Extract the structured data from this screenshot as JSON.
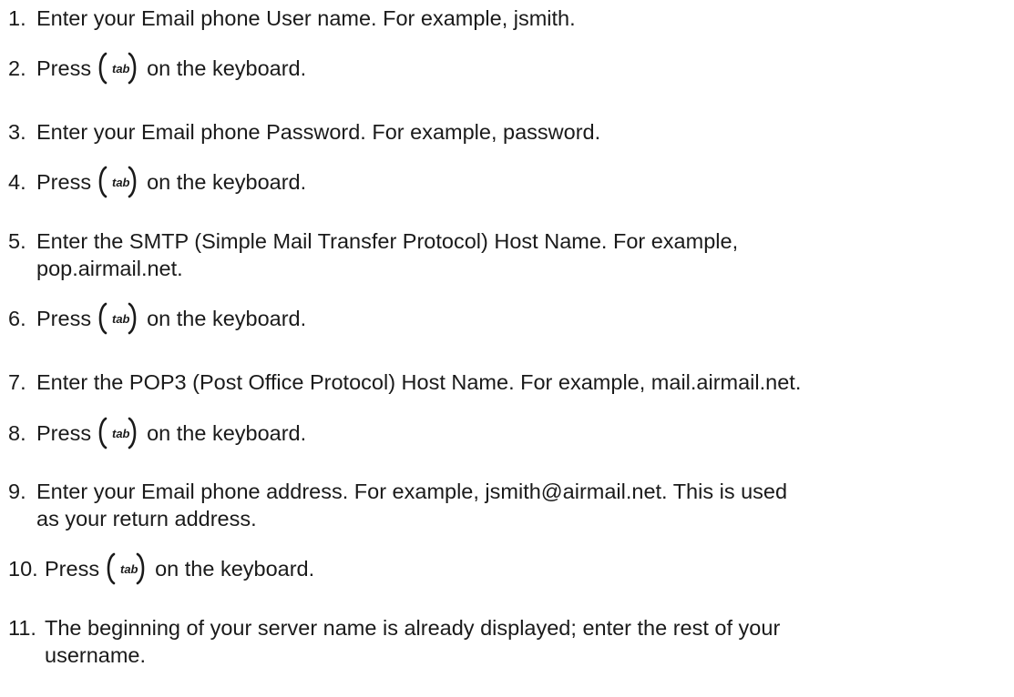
{
  "tab_key_label": "tab",
  "steps": [
    {
      "number": "1.",
      "lines": [
        "Enter your Email phone User name. For example, jsmith."
      ]
    },
    {
      "number": "2.",
      "before": "Press",
      "after": "on the keyboard."
    },
    {
      "number": "3.",
      "lines": [
        "Enter your Email phone Password. For example, password."
      ]
    },
    {
      "number": "4.",
      "before": "Press",
      "after": "on the keyboard."
    },
    {
      "number": "5.",
      "lines": [
        "Enter the SMTP (Simple Mail Transfer Protocol) Host Name. For example,",
        "pop.airmail.net."
      ]
    },
    {
      "number": "6.",
      "before": "Press",
      "after": "on the keyboard."
    },
    {
      "number": "7.",
      "lines": [
        "Enter the POP3 (Post Office Protocol) Host Name. For example, mail.airmail.net."
      ]
    },
    {
      "number": "8.",
      "before": "Press",
      "after": "on the keyboard."
    },
    {
      "number": "9.",
      "lines": [
        "Enter your Email phone address. For example, jsmith@airmail.net. This is used",
        "as your return address."
      ]
    },
    {
      "number": "10.",
      "before": "Press",
      "after": "on the keyboard."
    },
    {
      "number": "11.",
      "lines": [
        "The beginning of your server name is already displayed; enter the rest of your",
        "username."
      ]
    }
  ]
}
